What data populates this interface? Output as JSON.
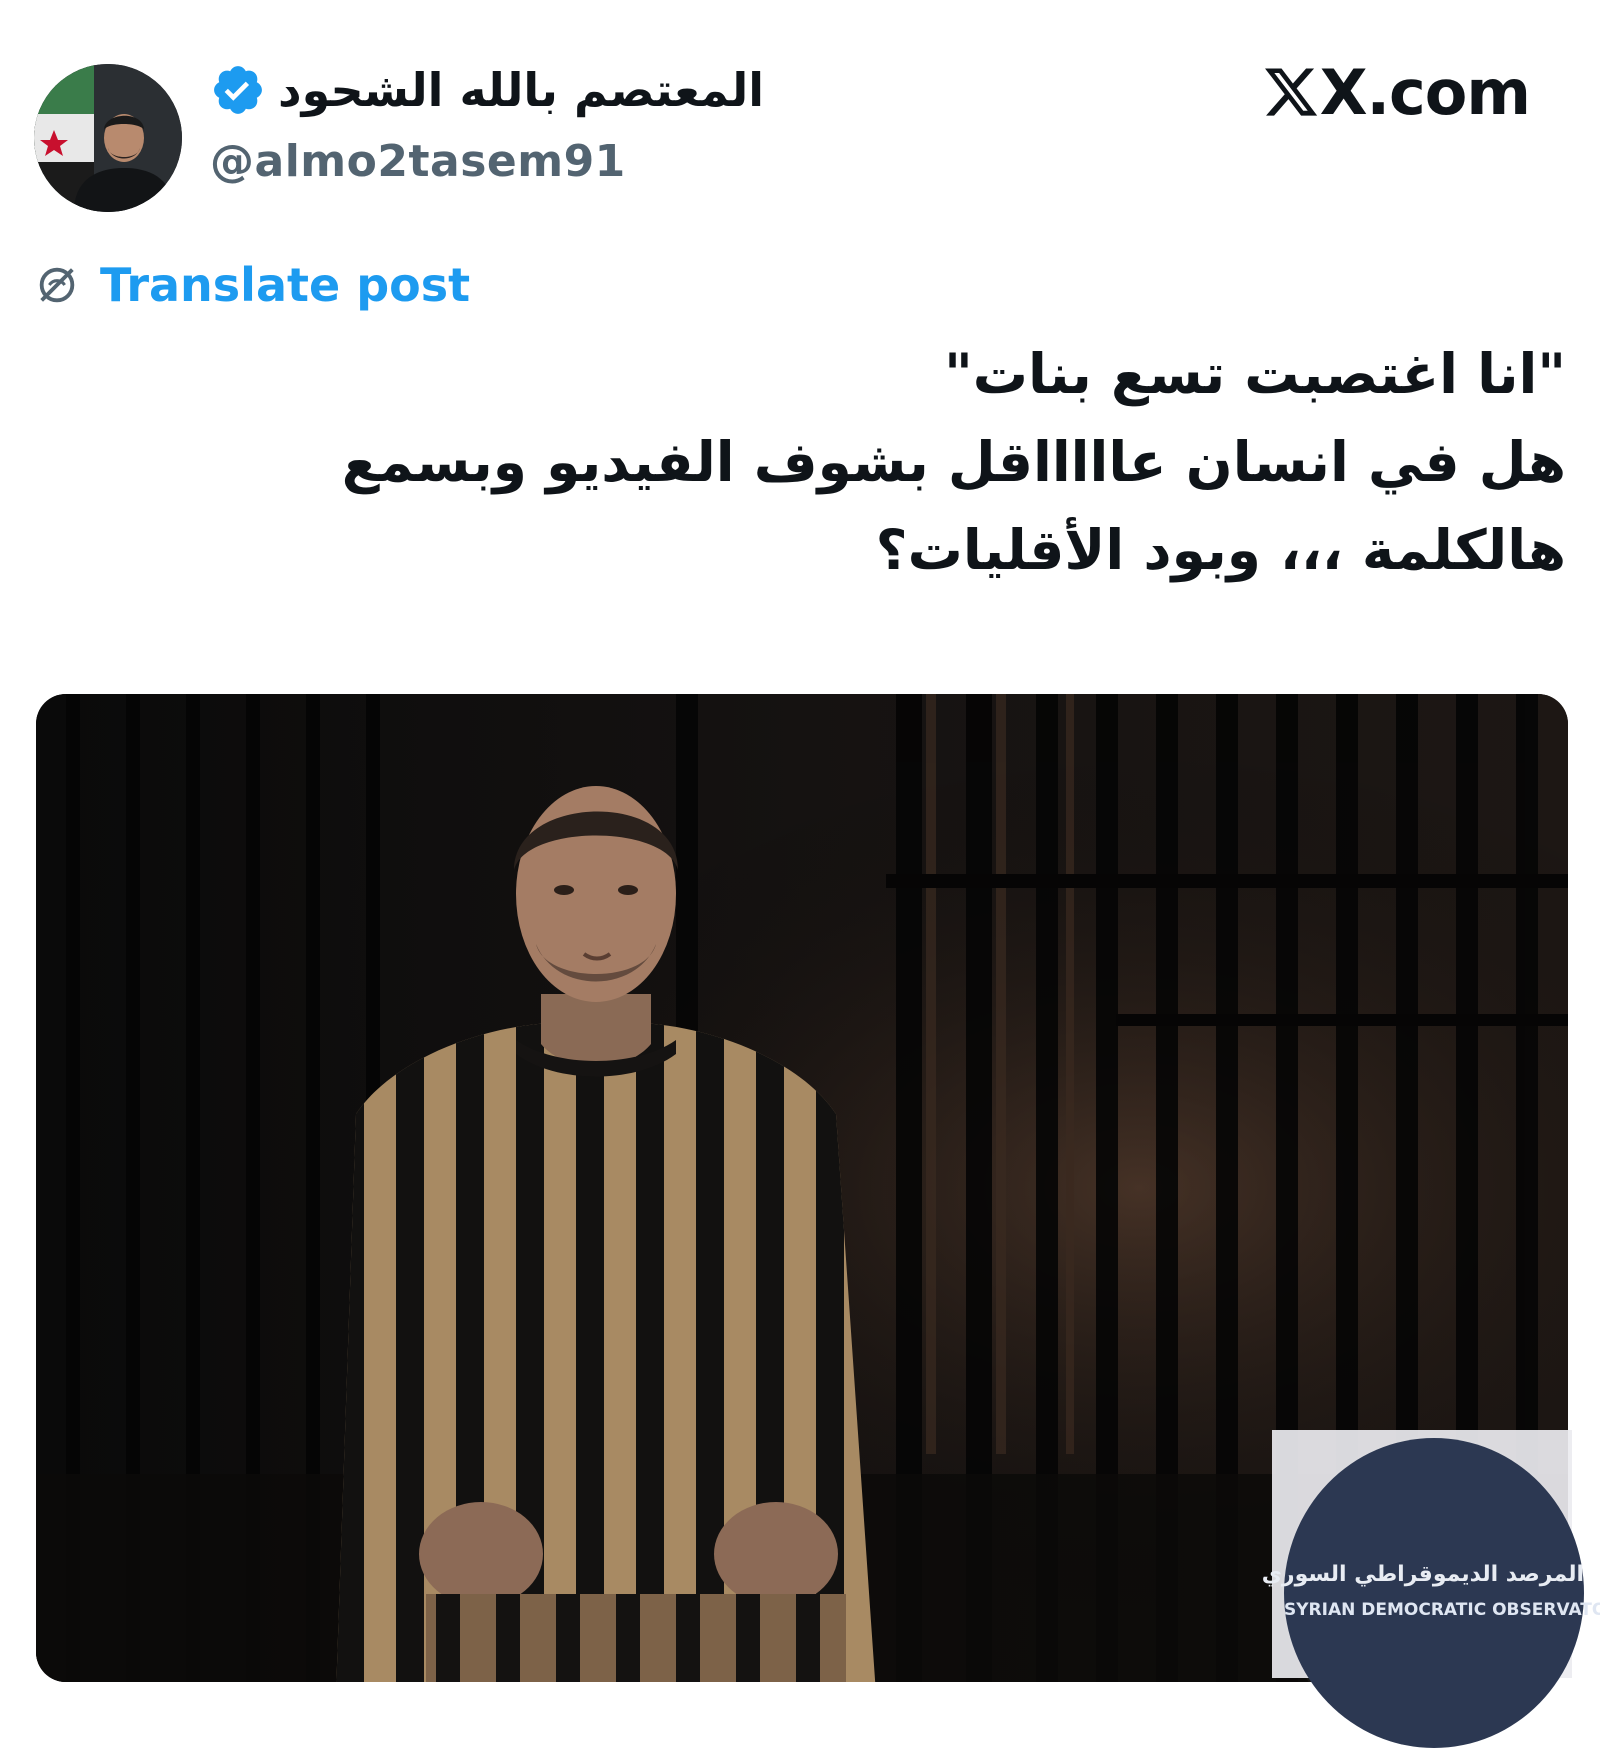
{
  "header": {
    "display_name": "المعتصم بالله الشحود",
    "handle": "@almo2tasem91",
    "verified_icon": "verified-badge-icon",
    "avatar_icon": "profile-avatar",
    "site_label": "X.com",
    "site_icon": "x-logo-icon"
  },
  "translate": {
    "label": "Translate post",
    "icon": "globe-icon"
  },
  "post": {
    "lines": [
      "\"انا اغتصبت تسع بنات\"",
      "هل في انسان عاااااقل بشوف الفيديو وبسمع",
      "هالكلمة ،،، وبود الأقليات؟"
    ]
  },
  "media": {
    "description_icon": "photo-prisoner-striped-uniform"
  },
  "watermark": {
    "arabic": "المرصد الديموقراطي السوري",
    "english": "SYRIAN DEMOCRATIC OBSERVATORY"
  },
  "colors": {
    "accent": "#1d9bf0",
    "text": "#0f1419",
    "secondary": "#536471",
    "stripe_tan": "#a88a63"
  }
}
